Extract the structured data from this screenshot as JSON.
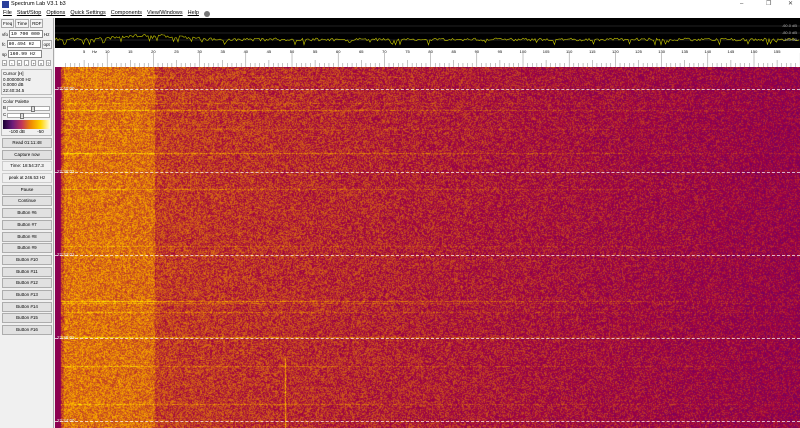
{
  "window": {
    "title": "Spectrum Lab V3.1 b3",
    "minimize": "–",
    "maximize": "❐",
    "close": "✕"
  },
  "menu": [
    "File",
    "Start/Stop",
    "Options",
    "Quick Settings",
    "Components",
    "View/Windows",
    "Help"
  ],
  "left": {
    "tabs": [
      "Freq",
      "Time",
      "RDF"
    ],
    "vfo_label": "vfo",
    "vfo": "10 700 000",
    "vfo_unit": "Hz",
    "fc_label": "fc",
    "fc": "80.494 Hz",
    "opt": "opt",
    "sp_label": "sp",
    "sp": "160.99 Hz",
    "arrows": [
      "«",
      "‹",
      "»",
      "-",
      "+",
      "×",
      "?"
    ],
    "cursor": {
      "title": "Cursor [H]",
      "freq": "0.0000000 Hz",
      "level": "0.0000 dB",
      "time": "22:40:34.5"
    },
    "palette": {
      "title": "Color Palette",
      "b": "B",
      "c": "C",
      "min": "-100 dB",
      "max": "-50",
      "brightness": 0.55,
      "contrast": 0.3
    },
    "buttons": [
      "Read 01:11:48",
      "Capture now",
      "Time:  18:54:37.3",
      "peak at 246.53 Hz",
      "Pause",
      "Continue",
      "Button #6",
      "Button #7",
      "Button #8",
      "Button #9",
      "Button #10",
      "Button #11",
      "Button #12",
      "Button #13",
      "Button #14",
      "Button #15",
      "Button #16"
    ]
  },
  "spectrum": {
    "db_labels": [
      "-60.0 dB",
      "-80.0 dB",
      "-100 dB"
    ],
    "trace_color": "#c8c800"
  },
  "scale": {
    "unit": "Hz",
    "ticks": [
      "5",
      "10",
      "15",
      "20",
      "25",
      "30",
      "35",
      "40",
      "45",
      "50",
      "55",
      "60",
      "65",
      "70",
      "75",
      "80",
      "85",
      "90",
      "95",
      "100",
      "105",
      "110",
      "115",
      "120",
      "125",
      "130",
      "135",
      "140",
      "145",
      "150",
      "155"
    ]
  },
  "waterfall": {
    "time_labels": [
      "22:40:00",
      "22:36:01",
      "22:32:01",
      "22:28:01",
      "22:24:00"
    ]
  }
}
